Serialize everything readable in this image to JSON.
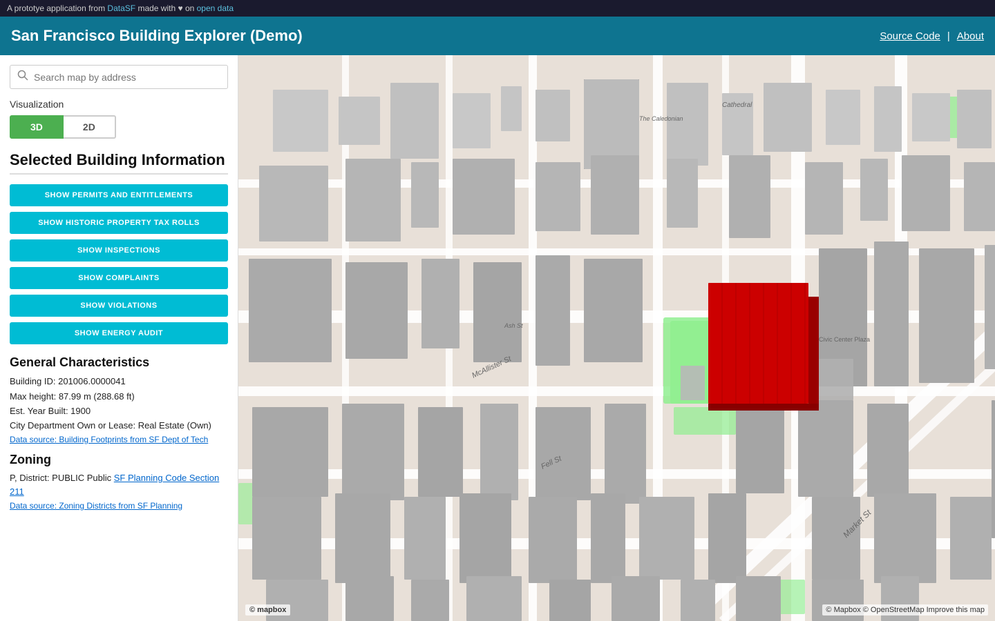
{
  "banner": {
    "text_before_link": "A prototye application from ",
    "datasf_label": "DataSF",
    "datasf_url": "#",
    "text_middle": " made with ♥ on ",
    "open_data_label": "open data",
    "open_data_url": "#"
  },
  "header": {
    "title": "San Francisco Building Explorer (Demo)",
    "nav": {
      "source_code_label": "Source Code",
      "divider": "|",
      "about_label": "About"
    }
  },
  "search": {
    "placeholder": "Search map by address"
  },
  "visualization": {
    "label": "Visualization",
    "btn_3d": "3D",
    "btn_2d": "2D"
  },
  "selected_building": {
    "title": "Selected Building Information",
    "buttons": [
      "SHOW PERMITS AND ENTITLEMENTS",
      "SHOW HISTORIC PROPERTY TAX ROLLS",
      "SHOW INSPECTIONS",
      "SHOW COMPLAINTS",
      "SHOW VIOLATIONS",
      "SHOW ENERGY AUDIT"
    ]
  },
  "general_characteristics": {
    "title": "General Characteristics",
    "fields": [
      "Building ID: 201006.0000041",
      "Max height: 87.99 m (288.68 ft)",
      "Est. Year Built: 1900",
      "City Department Own or Lease: Real Estate (Own)"
    ],
    "data_source": "Data source: Building Footprints from SF Dept of Tech"
  },
  "zoning": {
    "title": "Zoning",
    "description": "P, District: PUBLIC Public",
    "link_label": "SF Planning Code Section 211",
    "data_source": "Data source: Zoning Districts from SF Planning"
  },
  "map": {
    "attribution": "© Mapbox © OpenStreetMap Improve this map",
    "logo": "© mapbox"
  },
  "colors": {
    "header_bg": "#0e7490",
    "banner_bg": "#1a1a2e",
    "button_bg": "#00bcd4",
    "selected_building": "#cc0000",
    "highlight_ground": "#90ee90",
    "building_grey": "#b0b0b0",
    "viz_active": "#4caf50"
  }
}
